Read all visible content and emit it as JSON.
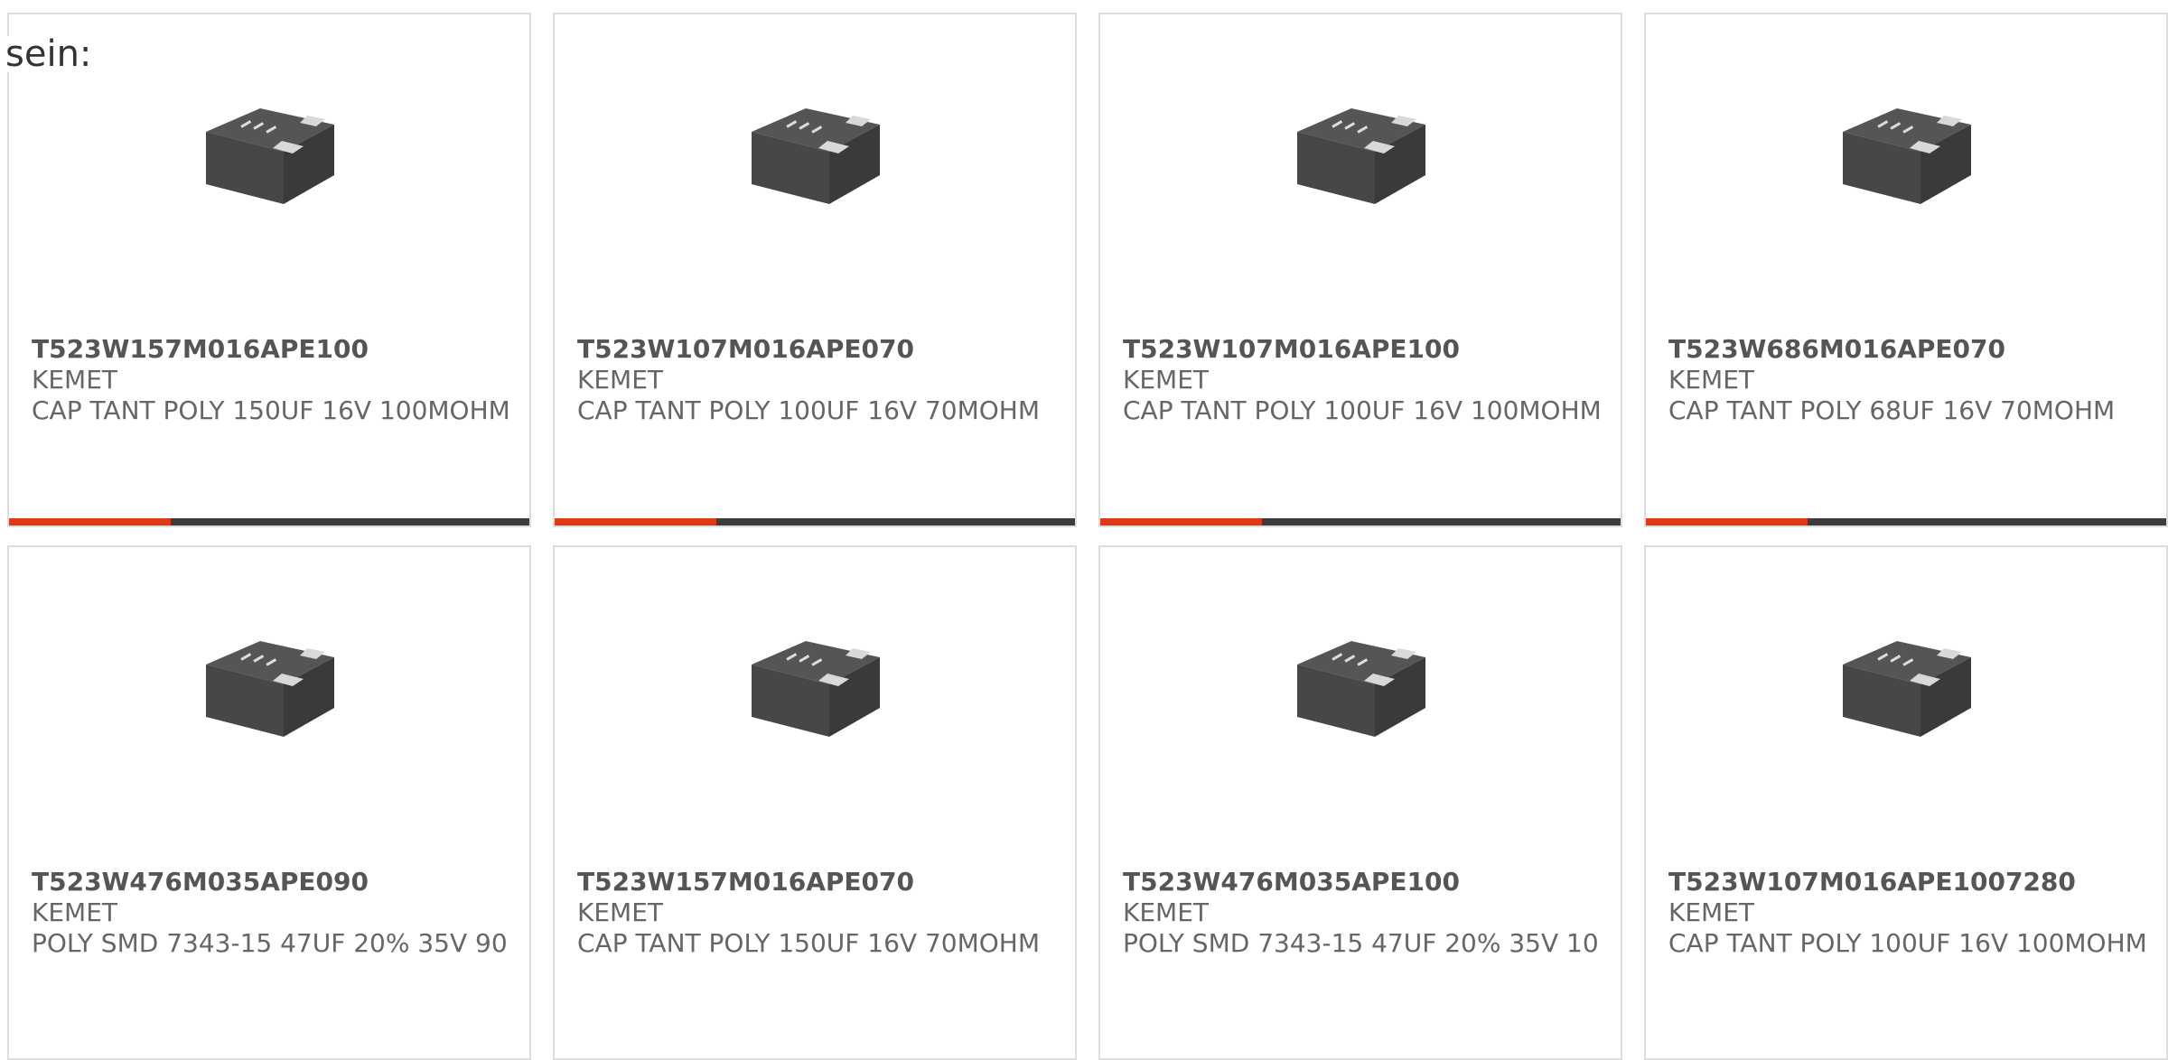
{
  "intro_text": "sein:",
  "products": [
    {
      "part_number": "T523W157M016APE100",
      "manufacturer": "KEMET",
      "description": "CAP TANT POLY 150UF 16V 100MOHM",
      "progress": 0.31
    },
    {
      "part_number": "T523W107M016APE070",
      "manufacturer": "KEMET",
      "description": "CAP TANT POLY 100UF 16V 70MOHM",
      "progress": 0.31
    },
    {
      "part_number": "T523W107M016APE100",
      "manufacturer": "KEMET",
      "description": "CAP TANT POLY 100UF 16V 100MOHM",
      "progress": 0.31
    },
    {
      "part_number": "T523W686M016APE070",
      "manufacturer": "KEMET",
      "description": "CAP TANT POLY 68UF 16V 70MOHM",
      "progress": 0.31
    },
    {
      "part_number": "T523W476M035APE090",
      "manufacturer": "KEMET",
      "description": "POLY SMD 7343-15 47UF 20% 35V 90",
      "progress": null
    },
    {
      "part_number": "T523W157M016APE070",
      "manufacturer": "KEMET",
      "description": "CAP TANT POLY 150UF 16V 70MOHM",
      "progress": null
    },
    {
      "part_number": "T523W476M035APE100",
      "manufacturer": "KEMET",
      "description": "POLY SMD 7343-15 47UF 20% 35V 10",
      "progress": null
    },
    {
      "part_number": "T523W107M016APE1007280",
      "manufacturer": "KEMET",
      "description": "CAP TANT POLY 100UF 16V 100MOHM",
      "progress": null
    }
  ],
  "colors": {
    "progress_fill": "#e03a12",
    "progress_track": "#3c3c3c",
    "card_border": "#dddddd",
    "text": "#666666"
  },
  "icon": "capacitor-chip-icon"
}
